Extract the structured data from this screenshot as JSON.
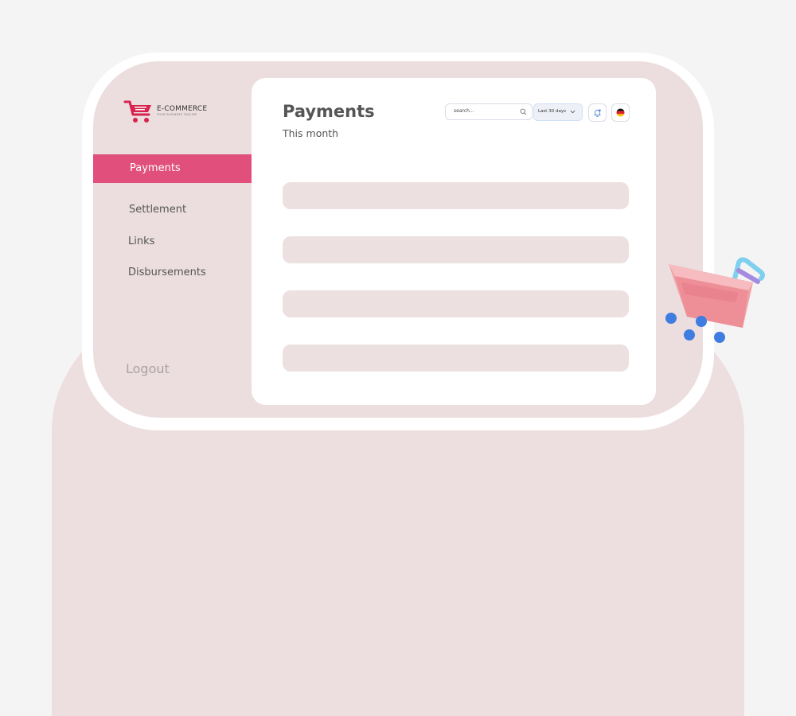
{
  "brand": {
    "name": "E-COMMERCE",
    "tagline": "YOUR BUSINESS TAGLINE"
  },
  "sidebar": {
    "items": [
      {
        "label": "Payments",
        "active": true
      },
      {
        "label": "Settlement"
      },
      {
        "label": "Links"
      },
      {
        "label": "Disbursements"
      }
    ],
    "logout_label": "Logout"
  },
  "header": {
    "title": "Payments",
    "subtitle": "This month",
    "search": {
      "placeholder": "search..."
    },
    "date_filter": {
      "value": "Last 30 days"
    }
  },
  "colors": {
    "accent": "#e1507d",
    "panel": "#ecdedf",
    "row": "#ede0e1"
  },
  "icons": [
    "cart-logo-icon",
    "search-icon",
    "chevron-down-icon",
    "bell-icon",
    "germany-flag-icon",
    "shopping-cart-3d-icon"
  ]
}
